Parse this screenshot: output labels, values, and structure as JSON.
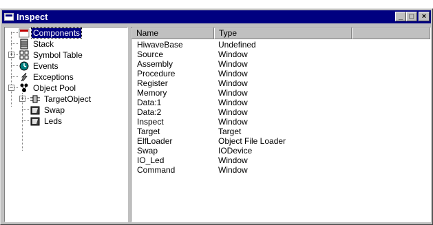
{
  "window": {
    "title": "Inspect",
    "buttons": {
      "minimize": "_",
      "maximize": "□",
      "close": "×"
    }
  },
  "tree": {
    "items": [
      {
        "label": "Components",
        "icon": "components-icon",
        "selected": true
      },
      {
        "label": "Stack",
        "icon": "stack-icon"
      },
      {
        "label": "Symbol Table",
        "icon": "symbol-table-icon",
        "expander": "+"
      },
      {
        "label": "Events",
        "icon": "events-icon"
      },
      {
        "label": "Exceptions",
        "icon": "exceptions-icon"
      },
      {
        "label": "Object Pool",
        "icon": "object-pool-icon",
        "expander": "−"
      },
      {
        "label": "TargetObject",
        "icon": "target-object-icon",
        "expander": "+"
      },
      {
        "label": "Swap",
        "icon": "swap-icon"
      },
      {
        "label": "Leds",
        "icon": "leds-icon"
      }
    ]
  },
  "list": {
    "columns": [
      "Name",
      "Type"
    ],
    "rows": [
      {
        "name": "HiwaveBase",
        "type": "Undefined"
      },
      {
        "name": "Source",
        "type": "Window"
      },
      {
        "name": "Assembly",
        "type": "Window"
      },
      {
        "name": "Procedure",
        "type": "Window"
      },
      {
        "name": "Register",
        "type": "Window"
      },
      {
        "name": "Memory",
        "type": "Window"
      },
      {
        "name": "Data:1",
        "type": "Window"
      },
      {
        "name": "Data:2",
        "type": "Window"
      },
      {
        "name": "Inspect",
        "type": "Window"
      },
      {
        "name": "Target",
        "type": "Target"
      },
      {
        "name": "ElfLoader",
        "type": "Object File Loader"
      },
      {
        "name": "Swap",
        "type": "IODevice"
      },
      {
        "name": "IO_Led",
        "type": "Window"
      },
      {
        "name": "Command",
        "type": "Window"
      }
    ]
  }
}
